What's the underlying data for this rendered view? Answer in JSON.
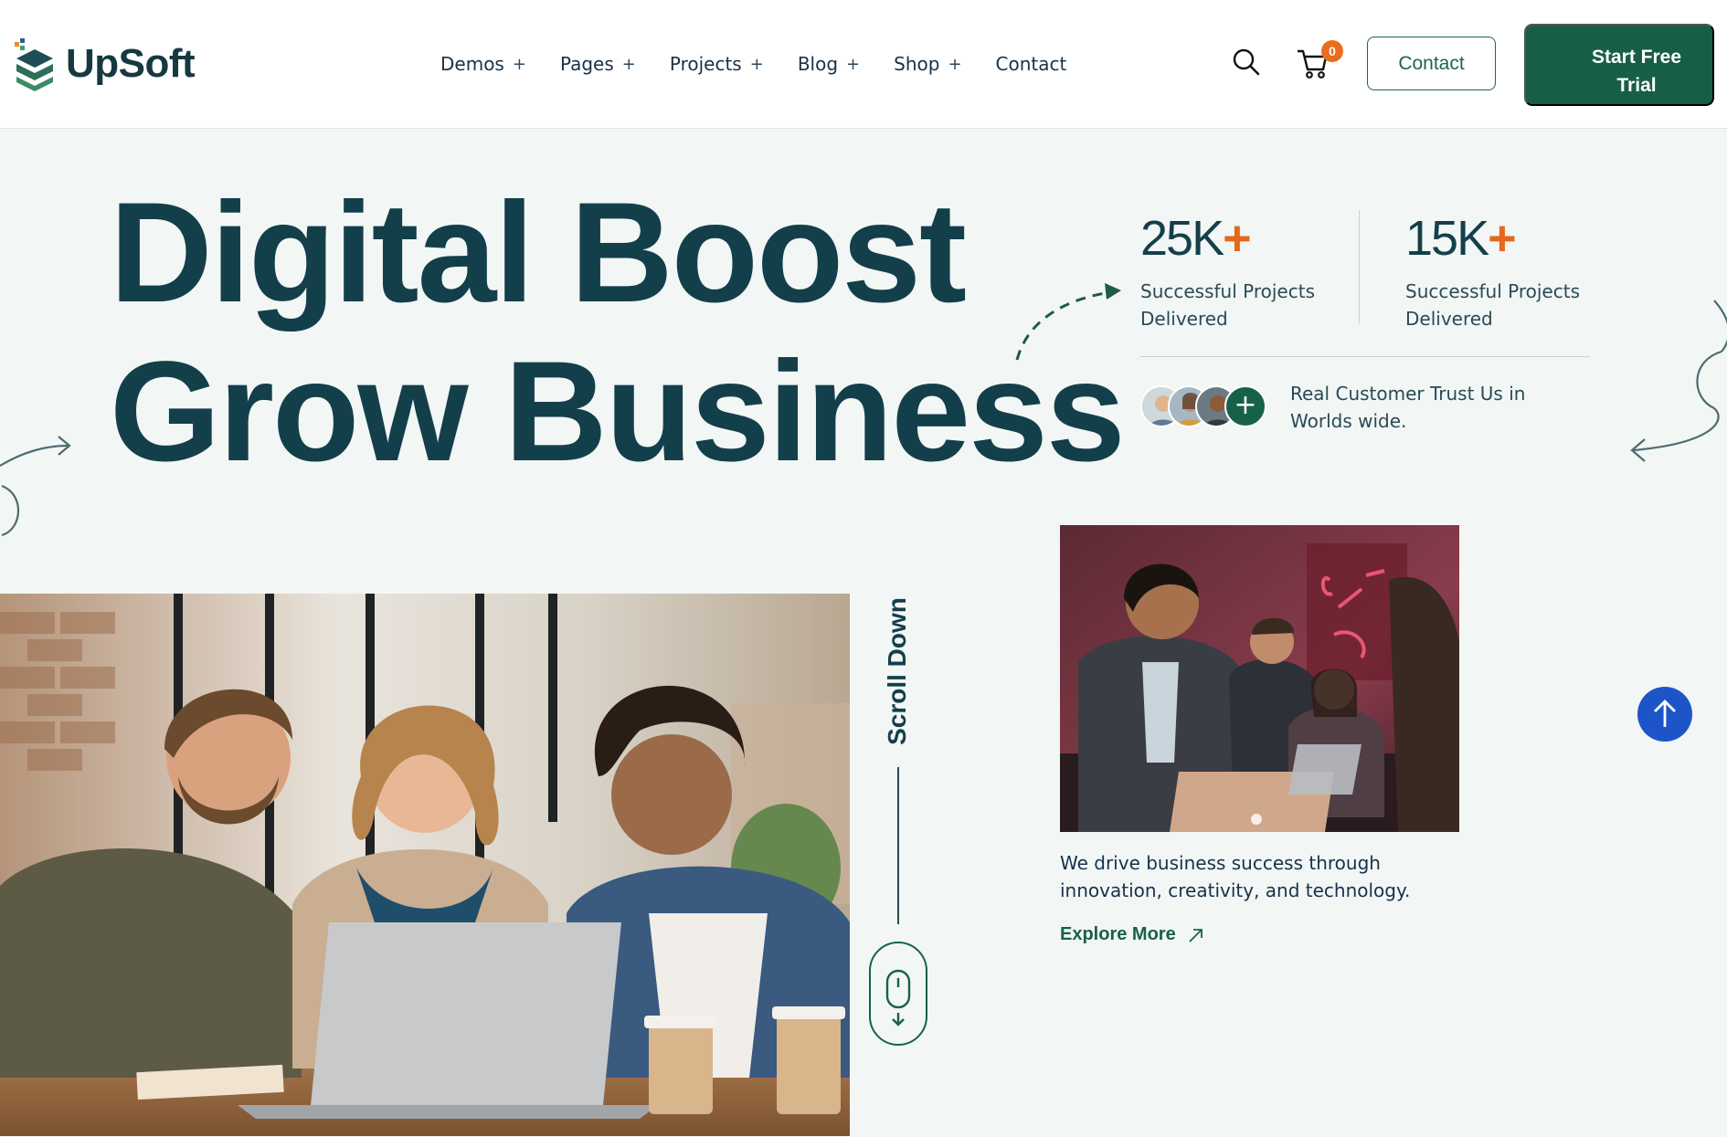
{
  "brand": {
    "name": "UpSoft"
  },
  "nav": {
    "items": [
      {
        "label": "Demos",
        "has_submenu": true
      },
      {
        "label": "Pages",
        "has_submenu": true
      },
      {
        "label": "Projects",
        "has_submenu": true
      },
      {
        "label": "Blog",
        "has_submenu": true
      },
      {
        "label": "Shop",
        "has_submenu": true
      },
      {
        "label": "Contact",
        "has_submenu": false
      }
    ],
    "submenu_symbol": "+"
  },
  "header_actions": {
    "search_icon": "search-icon",
    "cart_icon": "cart-icon",
    "cart_count": "0",
    "contact_label": "Contact",
    "trial_label_line1": "Start Free",
    "trial_label_line2": "Trial"
  },
  "hero": {
    "title_line1": "Digital Boost",
    "title_line2": "Grow Business"
  },
  "stats": [
    {
      "number": "25K",
      "suffix": "+",
      "label": "Successful Projects Delivered"
    },
    {
      "number": "15K",
      "suffix": "+",
      "label": "Successful Projects Delivered"
    }
  ],
  "trust": {
    "text": "Real Customer Trust Us in Worlds wide.",
    "plus_symbol": "+"
  },
  "scroll": {
    "label": "Scroll Down"
  },
  "feature": {
    "description": "We drive business success through innovation, creativity, and technology.",
    "cta_label": "Explore More"
  },
  "colors": {
    "primary": "#175e48",
    "heading": "#133f4b",
    "accent": "#e8661c",
    "background": "#f2f6f5",
    "back_to_top": "#1d55c9"
  }
}
